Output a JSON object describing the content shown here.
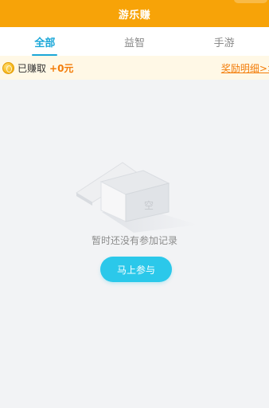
{
  "header": {
    "title": "游乐赚"
  },
  "tabs": [
    {
      "label": "全部",
      "active": true
    },
    {
      "label": "益智",
      "active": false
    },
    {
      "label": "手游",
      "active": false
    }
  ],
  "earnings": {
    "icon": "coin-icon",
    "label": "已赚取",
    "amount": "+0元",
    "reward_link": "奖励明细>>"
  },
  "empty_state": {
    "illustration": "empty-box-illustration",
    "box_mark": "空",
    "message": "暂时还没有参加记录",
    "button_label": "马上参与"
  },
  "colors": {
    "header": "#f7a308",
    "active_tab": "#1ba7d8",
    "earnings_bg": "#fff8e6",
    "accent": "#f37d0a",
    "button": "#2bc8ea",
    "page_bg": "#f2f3f5"
  }
}
